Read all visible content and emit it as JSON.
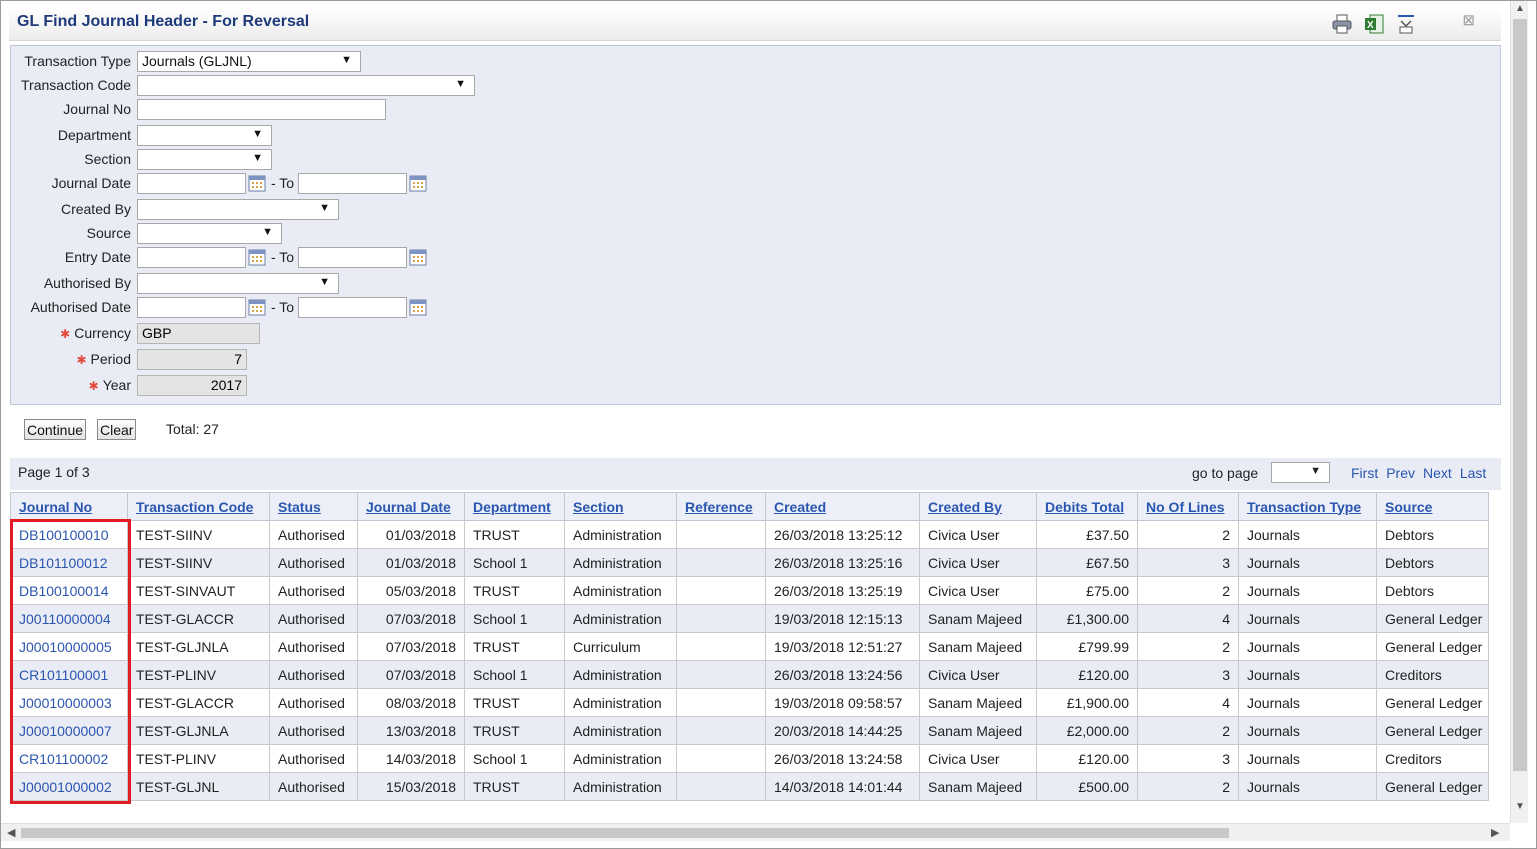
{
  "window": {
    "title": "GL Find Journal Header - For Reversal",
    "close_label": "⊠"
  },
  "toolbar": {
    "icons": [
      "print-icon",
      "excel-icon",
      "collapse-icon"
    ]
  },
  "form": {
    "transaction_type": {
      "label": "Transaction Type",
      "value": "Journals (GLJNL)"
    },
    "transaction_code": {
      "label": "Transaction Code",
      "value": ""
    },
    "journal_no": {
      "label": "Journal No",
      "value": ""
    },
    "department": {
      "label": "Department",
      "value": ""
    },
    "section": {
      "label": "Section",
      "value": ""
    },
    "journal_date": {
      "label": "Journal Date",
      "to_label": "- To",
      "from": "",
      "to": ""
    },
    "created_by": {
      "label": "Created By",
      "value": ""
    },
    "source": {
      "label": "Source",
      "value": ""
    },
    "entry_date": {
      "label": "Entry Date",
      "to_label": "- To",
      "from": "",
      "to": ""
    },
    "authorised_by": {
      "label": "Authorised By",
      "value": ""
    },
    "authorised_date": {
      "label": "Authorised Date",
      "to_label": "- To",
      "from": "",
      "to": ""
    },
    "currency": {
      "label": "Currency",
      "value": "GBP"
    },
    "period": {
      "label": "Period",
      "value": "7"
    },
    "year": {
      "label": "Year",
      "value": "2017"
    },
    "required_marker": "✱"
  },
  "actions": {
    "continue_label": "Continue",
    "clear_label": "Clear",
    "total_text": "Total: 27"
  },
  "pager": {
    "page_info": "Page 1 of 3",
    "goto_label": "go to page",
    "goto_value": "",
    "first": "First",
    "prev": "Prev",
    "next": "Next",
    "last": "Last"
  },
  "table": {
    "columns": [
      "Journal No",
      "Transaction Code",
      "Status",
      "Journal Date",
      "Department",
      "Section",
      "Reference",
      "Created",
      "Created By",
      "Debits Total",
      "No Of Lines",
      "Transaction Type",
      "Source"
    ],
    "rows": [
      [
        "DB100100010",
        "TEST-SIINV",
        "Authorised",
        "01/03/2018",
        "TRUST",
        "Administration",
        "",
        "26/03/2018 13:25:12",
        "Civica User",
        "£37.50",
        "2",
        "Journals",
        "Debtors"
      ],
      [
        "DB101100012",
        "TEST-SIINV",
        "Authorised",
        "01/03/2018",
        "School 1",
        "Administration",
        "",
        "26/03/2018 13:25:16",
        "Civica User",
        "£67.50",
        "3",
        "Journals",
        "Debtors"
      ],
      [
        "DB100100014",
        "TEST-SINVAUT",
        "Authorised",
        "05/03/2018",
        "TRUST",
        "Administration",
        "",
        "26/03/2018 13:25:19",
        "Civica User",
        "£75.00",
        "2",
        "Journals",
        "Debtors"
      ],
      [
        "J00110000004",
        "TEST-GLACCR",
        "Authorised",
        "07/03/2018",
        "School 1",
        "Administration",
        "",
        "19/03/2018 12:15:13",
        "Sanam Majeed",
        "£1,300.00",
        "4",
        "Journals",
        "General Ledger"
      ],
      [
        "J00010000005",
        "TEST-GLJNLA",
        "Authorised",
        "07/03/2018",
        "TRUST",
        "Curriculum",
        "",
        "19/03/2018 12:51:27",
        "Sanam Majeed",
        "£799.99",
        "2",
        "Journals",
        "General Ledger"
      ],
      [
        "CR101100001",
        "TEST-PLINV",
        "Authorised",
        "07/03/2018",
        "School 1",
        "Administration",
        "",
        "26/03/2018 13:24:56",
        "Civica User",
        "£120.00",
        "3",
        "Journals",
        "Creditors"
      ],
      [
        "J00010000003",
        "TEST-GLACCR",
        "Authorised",
        "08/03/2018",
        "TRUST",
        "Administration",
        "",
        "19/03/2018 09:58:57",
        "Sanam Majeed",
        "£1,900.00",
        "4",
        "Journals",
        "General Ledger"
      ],
      [
        "J00010000007",
        "TEST-GLJNLA",
        "Authorised",
        "13/03/2018",
        "TRUST",
        "Administration",
        "",
        "20/03/2018 14:44:25",
        "Sanam Majeed",
        "£2,000.00",
        "2",
        "Journals",
        "General Ledger"
      ],
      [
        "CR101100002",
        "TEST-PLINV",
        "Authorised",
        "14/03/2018",
        "School 1",
        "Administration",
        "",
        "26/03/2018 13:24:58",
        "Civica User",
        "£120.00",
        "3",
        "Journals",
        "Creditors"
      ],
      [
        "J00001000002",
        "TEST-GLJNL",
        "Authorised",
        "15/03/2018",
        "TRUST",
        "Administration",
        "",
        "14/03/2018 14:01:44",
        "Sanam Majeed",
        "£500.00",
        "2",
        "Journals",
        "General Ledger"
      ]
    ]
  },
  "colors": {
    "accent": "#2a56b0",
    "highlight": "#e01b24",
    "panel": "#e9ecf5"
  }
}
